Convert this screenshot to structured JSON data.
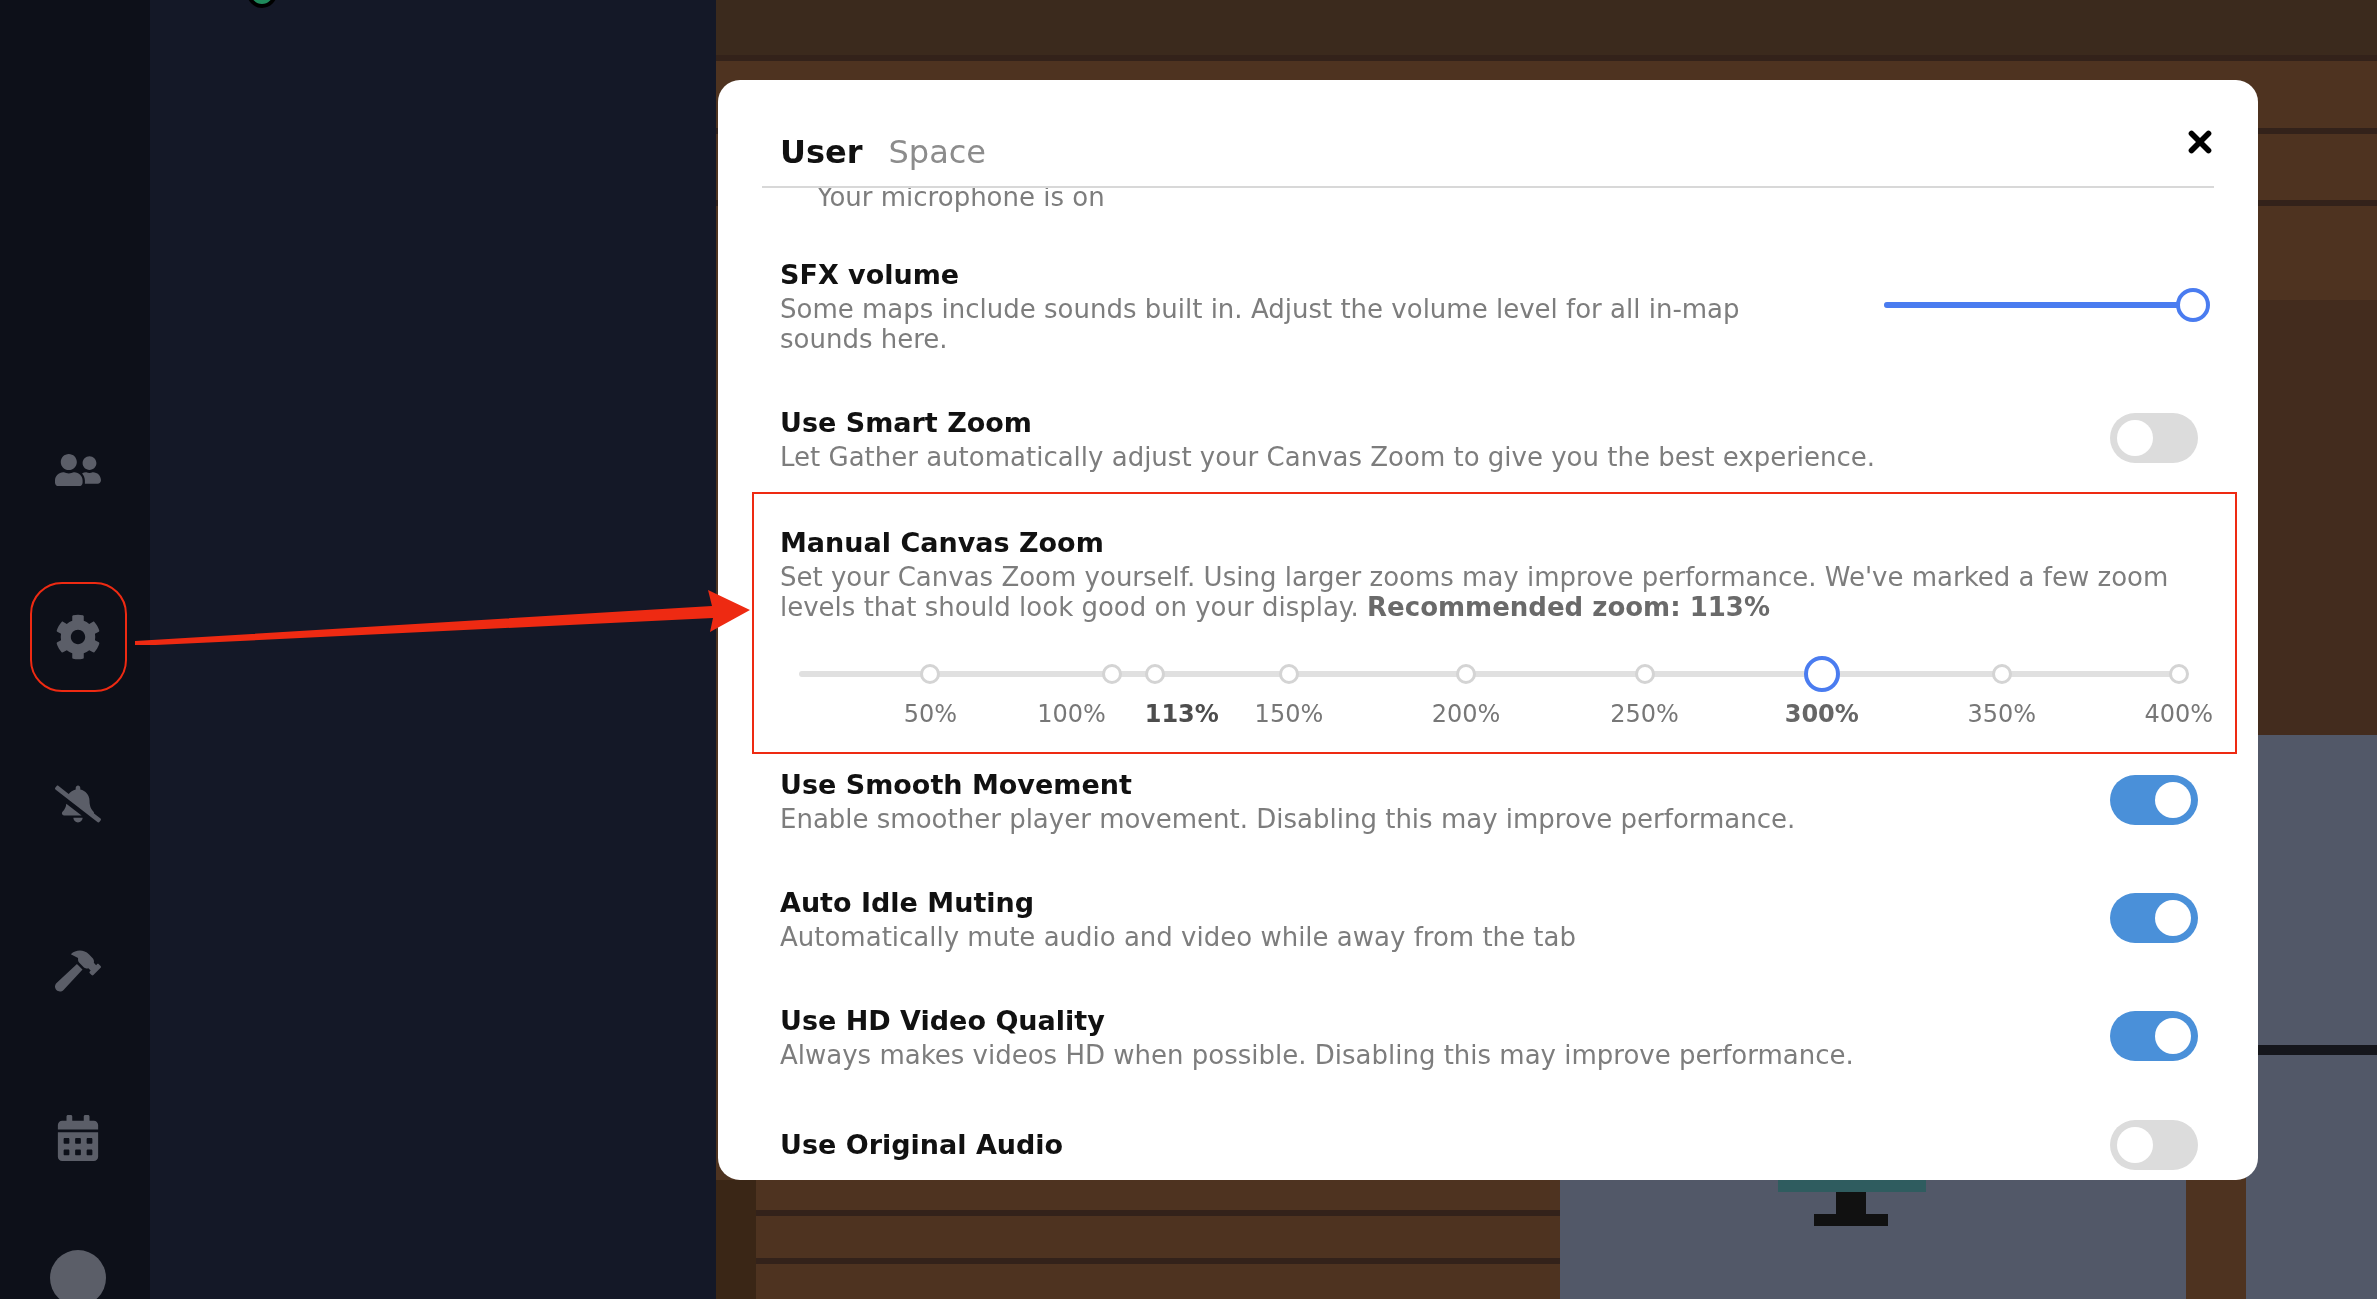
{
  "sidebar": {
    "items": [
      {
        "kind": "people",
        "highlighted": false
      },
      {
        "kind": "settings",
        "highlighted": true
      },
      {
        "kind": "notifications_off",
        "highlighted": false
      },
      {
        "kind": "build",
        "highlighted": false
      },
      {
        "kind": "calendar",
        "highlighted": false
      }
    ]
  },
  "dialog": {
    "tabs": [
      {
        "label": "User",
        "selected": true
      },
      {
        "label": "Space",
        "selected": false
      }
    ],
    "settings": [
      {
        "kind": "note",
        "description": "Your microphone is on"
      },
      {
        "kind": "slider",
        "title": "SFX volume",
        "description": "Some maps include sounds built in. Adjust the volume level for all in-map sounds here.",
        "level": 1
      },
      {
        "kind": "toggle",
        "title": "Use Smart Zoom",
        "description": "Let Gather automatically adjust your Canvas Zoom to give you the best experience.",
        "on": false
      },
      {
        "kind": "zoom",
        "title": "Manual Canvas Zoom",
        "description": "Set your Canvas Zoom yourself. Using larger zooms may improve performance. We've marked a few zoom levels that should look good on your display. **Recommended zoom: 113%**",
        "highlighted": true,
        "marks": [
          {
            "label": "50%",
            "level": 0.095,
            "selected": false,
            "recommended": false
          },
          {
            "label": "100%",
            "level": 0.226,
            "selected": false,
            "recommended": false
          },
          {
            "label": "113%",
            "level": 0.257,
            "selected": false,
            "recommended": true
          },
          {
            "label": "150%",
            "level": 0.354,
            "selected": false,
            "recommended": false
          },
          {
            "label": "200%",
            "level": 0.482,
            "selected": false,
            "recommended": false
          },
          {
            "label": "250%",
            "level": 0.611,
            "selected": false,
            "recommended": false
          },
          {
            "label": "300%",
            "level": 0.739,
            "selected": true,
            "recommended": false
          },
          {
            "label": "350%",
            "level": 0.869,
            "selected": false,
            "recommended": false
          },
          {
            "label": "400%",
            "level": 0.997,
            "selected": false,
            "recommended": false
          }
        ]
      },
      {
        "kind": "toggle",
        "title": "Use Smooth Movement",
        "description": "Enable smoother player movement. Disabling this may improve performance.",
        "on": true
      },
      {
        "kind": "toggle",
        "title": "Auto Idle Muting",
        "description": "Automatically mute audio and video while away from the tab",
        "on": true
      },
      {
        "kind": "toggle",
        "title": "Use HD Video Quality",
        "description": "Always makes videos HD when possible. Disabling this may improve performance.",
        "on": true
      },
      {
        "kind": "toggle",
        "title": "Use Original Audio",
        "on": false
      }
    ]
  }
}
